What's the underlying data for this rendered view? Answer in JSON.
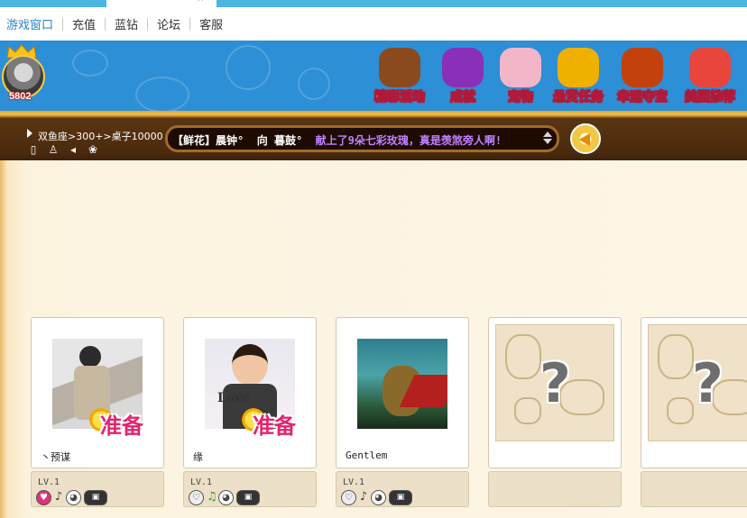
{
  "tab": {
    "label": "",
    "close": "×"
  },
  "links": [
    {
      "label": "游戏窗口",
      "active": true
    },
    {
      "label": "充值"
    },
    {
      "label": "蓝钻"
    },
    {
      "label": "论坛"
    },
    {
      "label": "客服"
    }
  ],
  "header": {
    "avatar_count": "5802",
    "icons": [
      {
        "label": "精彩活动",
        "icon": "bear-icon",
        "color": "#8a4a1e"
      },
      {
        "label": "成就",
        "icon": "trophy-icon",
        "color": "#8a2fb8"
      },
      {
        "label": "宠物",
        "icon": "pet-icon",
        "color": "#f2b6c8"
      },
      {
        "label": "悬赏任务",
        "icon": "coins-icon",
        "color": "#f0b000"
      },
      {
        "label": "幸运夺宝",
        "icon": "treasure-chest-icon",
        "color": "#c2410c"
      },
      {
        "label": "美图推荐",
        "icon": "picture-icon",
        "color": "#e8453c"
      }
    ]
  },
  "room": {
    "location": "双鱼座>300+>桌子10000",
    "ticker": {
      "tag": "【鲜花】",
      "sender": "晨钟°",
      "to": "向",
      "receiver": "暮鼓°",
      "message": "献上了9朵七彩玫瑰，真是羡煞旁人啊!"
    }
  },
  "players": [
    {
      "name": "丶预谋",
      "level": "LV.1",
      "ready": "准备",
      "heart_on": true,
      "note_on": false,
      "pic": "person-photo"
    },
    {
      "name": "缘",
      "level": "LV.1",
      "ready": "准备",
      "heart_on": false,
      "note_on": true,
      "pic": "cartoon-avatar"
    },
    {
      "name": "Gentlem",
      "level": "LV.1",
      "ready": "",
      "heart_on": false,
      "note_on": false,
      "pic": "monkey-king-art"
    }
  ],
  "empty_seat": {
    "symbol": "?"
  }
}
